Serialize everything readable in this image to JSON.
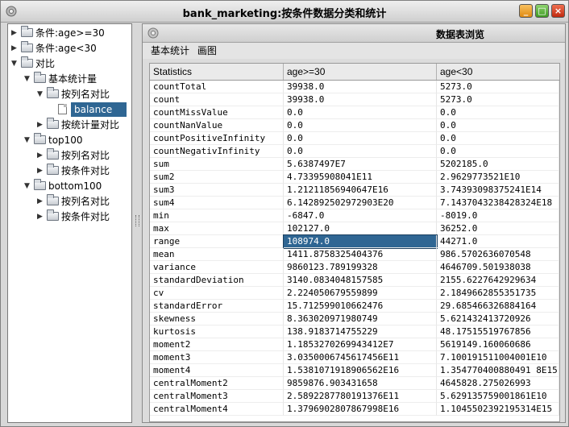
{
  "window": {
    "title": "bank_marketing:按条件数据分类和统计"
  },
  "tree": {
    "nodes": [
      {
        "label": "条件:age>=30",
        "depth": 0,
        "toggle": "▶",
        "icon": "folder-icon"
      },
      {
        "label": "条件:age<30",
        "depth": 0,
        "toggle": "▶",
        "icon": "folder-icon"
      },
      {
        "label": "对比",
        "depth": 0,
        "toggle": "▼",
        "icon": "folder-icon"
      },
      {
        "label": "基本统计量",
        "depth": 1,
        "toggle": "▼",
        "icon": "folder-icon"
      },
      {
        "label": "按列名对比",
        "depth": 2,
        "toggle": "▼",
        "icon": "folder-icon"
      },
      {
        "label": "balance",
        "depth": 3,
        "toggle": "",
        "icon": "file-icon",
        "selected": true
      },
      {
        "label": "按统计量对比",
        "depth": 2,
        "toggle": "▶",
        "icon": "folder-icon"
      },
      {
        "label": "top100",
        "depth": 1,
        "toggle": "▼",
        "icon": "folder-icon"
      },
      {
        "label": "按列名对比",
        "depth": 2,
        "toggle": "▶",
        "icon": "folder-icon"
      },
      {
        "label": "按条件对比",
        "depth": 2,
        "toggle": "▶",
        "icon": "folder-icon"
      },
      {
        "label": "bottom100",
        "depth": 1,
        "toggle": "▼",
        "icon": "folder-icon"
      },
      {
        "label": "按列名对比",
        "depth": 2,
        "toggle": "▶",
        "icon": "folder-icon"
      },
      {
        "label": "按条件对比",
        "depth": 2,
        "toggle": "▶",
        "icon": "folder-icon"
      }
    ]
  },
  "panel": {
    "title": "数据表浏览",
    "menu": [
      "基本统计",
      "画图"
    ]
  },
  "table": {
    "columns": [
      "Statistics",
      "age>=30",
      "age<30"
    ],
    "selected": {
      "row": 12,
      "col": 1
    },
    "rows": [
      [
        "countTotal",
        "39938.0",
        "5273.0"
      ],
      [
        "count",
        "39938.0",
        "5273.0"
      ],
      [
        "countMissValue",
        "0.0",
        "0.0"
      ],
      [
        "countNanValue",
        "0.0",
        "0.0"
      ],
      [
        "countPositiveInfinity",
        "0.0",
        "0.0"
      ],
      [
        "countNegativInfinity",
        "0.0",
        "0.0"
      ],
      [
        "sum",
        "5.6387497E7",
        "5202185.0"
      ],
      [
        "sum2",
        "4.73395908041E11",
        "2.9629773521E10"
      ],
      [
        "sum3",
        "1.21211856940647E16",
        "3.74393098375241E14"
      ],
      [
        "sum4",
        "6.142892502972903E20",
        "7.1437043238428324E18"
      ],
      [
        "min",
        "-6847.0",
        "-8019.0"
      ],
      [
        "max",
        "102127.0",
        "36252.0"
      ],
      [
        "range",
        "108974.0",
        "44271.0"
      ],
      [
        "mean",
        "1411.8758325404376",
        "986.5702636070548"
      ],
      [
        "variance",
        "9860123.789199328",
        "4646709.501938038"
      ],
      [
        "standardDeviation",
        "3140.0834048157585",
        "2155.6227642929634"
      ],
      [
        "cv",
        "2.224050679559899",
        "2.1849662855351735"
      ],
      [
        "standardError",
        "15.712599010662476",
        "29.685466326884164"
      ],
      [
        "skewness",
        "8.363020971980749",
        "5.621432413720926"
      ],
      [
        "kurtosis",
        "138.9183714755229",
        "48.17515519767856"
      ],
      [
        "moment2",
        "1.1853270269943412E7",
        "5619149.160060686"
      ],
      [
        "moment3",
        "3.0350006745617456E11",
        "7.100191511004001E10"
      ],
      [
        "moment4",
        "1.5381071918906562E16",
        "1.354770400880491 8E15"
      ],
      [
        "centralMoment2",
        "9859876.903431658",
        "4645828.275026993"
      ],
      [
        "centralMoment3",
        "2.5892287780191376E11",
        "5.629135759001861E10"
      ],
      [
        "centralMoment4",
        "1.3796902807867998E16",
        "1.1045502392195314E15"
      ]
    ]
  }
}
